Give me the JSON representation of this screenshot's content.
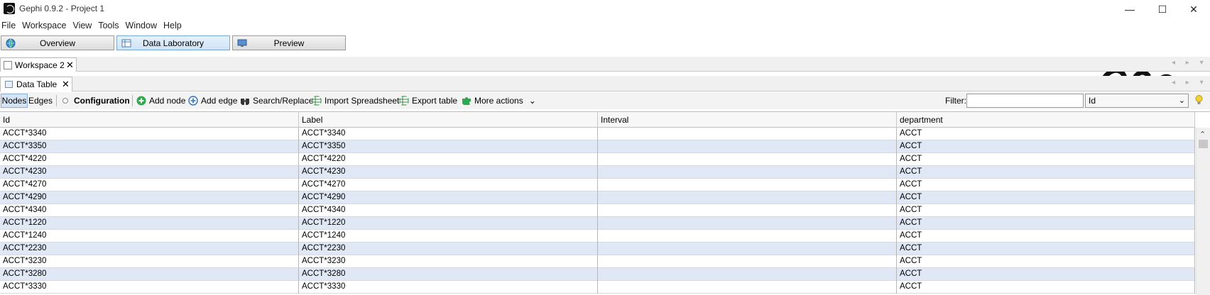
{
  "window": {
    "title": "Gephi 0.9.2 - Project 1",
    "controls": {
      "minimize": "—",
      "maximize": "☐",
      "close": "✕"
    }
  },
  "menu": [
    "File",
    "Workspace",
    "View",
    "Tools",
    "Window",
    "Help"
  ],
  "perspectives": [
    {
      "label": "Overview",
      "active": false
    },
    {
      "label": "Data Laboratory",
      "active": true
    },
    {
      "label": "Preview",
      "active": false
    }
  ],
  "workspace_tab": {
    "label": "Workspace 2",
    "close": "✕"
  },
  "data_table_tab": {
    "label": "Data Table",
    "close": "✕"
  },
  "toolbar": {
    "nodes": "Nodes",
    "edges": "Edges",
    "configuration": "Configuration",
    "add_node": "Add node",
    "add_edge": "Add edge",
    "search_replace": "Search/Replace",
    "import_spreadsheet": "Import Spreadsheet",
    "export_table": "Export table",
    "more_actions": "More actions",
    "more_actions_arrow": "⌄"
  },
  "filter": {
    "label": "Filter:",
    "value": "",
    "column": "Id",
    "arrow": "⌄"
  },
  "nav_arrows": "◂ ▸ ▾",
  "table": {
    "columns": [
      "Id",
      "Label",
      "Interval",
      "department"
    ],
    "rows": [
      [
        "ACCT*3340",
        "ACCT*3340",
        "",
        "ACCT"
      ],
      [
        "ACCT*3350",
        "ACCT*3350",
        "",
        "ACCT"
      ],
      [
        "ACCT*4220",
        "ACCT*4220",
        "",
        "ACCT"
      ],
      [
        "ACCT*4230",
        "ACCT*4230",
        "",
        "ACCT"
      ],
      [
        "ACCT*4270",
        "ACCT*4270",
        "",
        "ACCT"
      ],
      [
        "ACCT*4290",
        "ACCT*4290",
        "",
        "ACCT"
      ],
      [
        "ACCT*4340",
        "ACCT*4340",
        "",
        "ACCT"
      ],
      [
        "ACCT*1220",
        "ACCT*1220",
        "",
        "ACCT"
      ],
      [
        "ACCT*1240",
        "ACCT*1240",
        "",
        "ACCT"
      ],
      [
        "ACCT*2230",
        "ACCT*2230",
        "",
        "ACCT"
      ],
      [
        "ACCT*3230",
        "ACCT*3230",
        "",
        "ACCT"
      ],
      [
        "ACCT*3280",
        "ACCT*3280",
        "",
        "ACCT"
      ],
      [
        "ACCT*3330",
        "ACCT*3330",
        "",
        "ACCT"
      ]
    ]
  },
  "scroll_up": "⌃",
  "colors": {
    "accent": "#2f7fd0",
    "row_alt": "#dfe8f4",
    "selected_tab": "#d5e4f4"
  }
}
